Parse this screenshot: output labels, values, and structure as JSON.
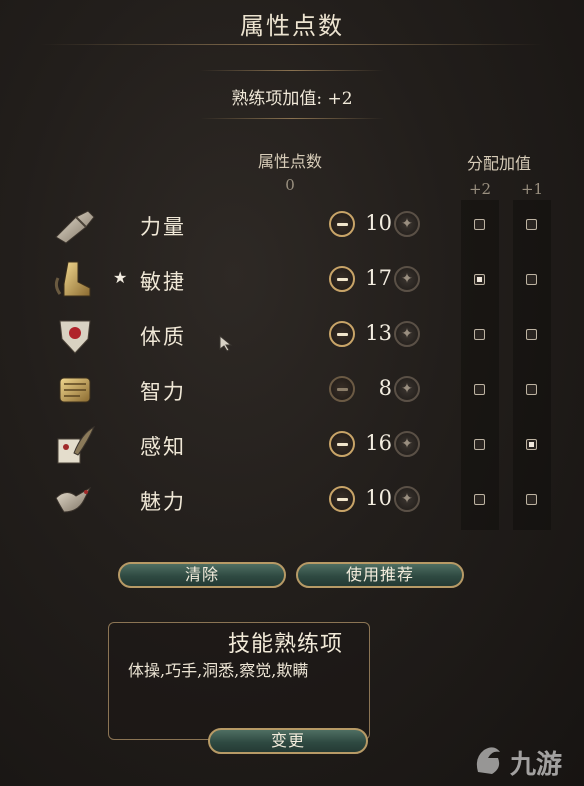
{
  "title": "属性点数",
  "proficiency_bonus": "熟练项加值: +2",
  "points_header": "属性点数",
  "points_remaining": "0",
  "bonus_header": "分配加值",
  "bonus_col_plus2": "+2",
  "bonus_col_plus1": "+1",
  "attributes": [
    {
      "name": "力量",
      "value": "10",
      "starred": false,
      "plus2": false,
      "plus1": false,
      "minus_enabled": true
    },
    {
      "name": "敏捷",
      "value": "17",
      "starred": true,
      "plus2": true,
      "plus1": false,
      "minus_enabled": true
    },
    {
      "name": "体质",
      "value": "13",
      "starred": false,
      "plus2": false,
      "plus1": false,
      "minus_enabled": true
    },
    {
      "name": "智力",
      "value": "8",
      "starred": false,
      "plus2": false,
      "plus1": false,
      "minus_enabled": false
    },
    {
      "name": "感知",
      "value": "16",
      "starred": false,
      "plus2": false,
      "plus1": true,
      "minus_enabled": true
    },
    {
      "name": "魅力",
      "value": "10",
      "starred": false,
      "plus2": false,
      "plus1": false,
      "minus_enabled": true
    }
  ],
  "star_glyph": "★",
  "clear_button": "清除",
  "recommend_button": "使用推荐",
  "skill_title": "技能熟练项",
  "skill_list": "体操,巧手,洞悉,察觉,欺瞒",
  "change_button": "变更",
  "watermark_text": "九游",
  "icons": [
    "strength-gauntlet-icon",
    "dexterity-boot-icon",
    "constitution-shield-icon",
    "intelligence-scroll-icon",
    "wisdom-feather-icon",
    "charisma-bird-icon"
  ],
  "colors": {
    "accent_gold": "#c8a468",
    "button_teal": "#3d5a50",
    "background": "#221e1b"
  }
}
